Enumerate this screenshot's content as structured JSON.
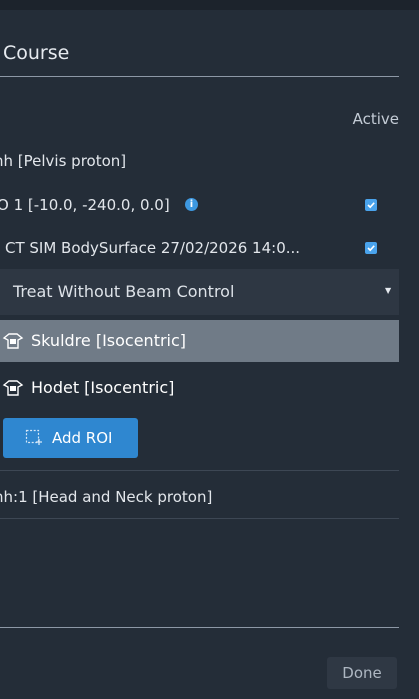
{
  "dialog": {
    "title": "Course",
    "column_header": "Active"
  },
  "plans": [
    {
      "label": "nh [Pelvis proton]"
    },
    {
      "label": "nh:1 [Head and Neck proton]"
    }
  ],
  "rows": {
    "isocenter": {
      "label": "O 1 [-10.0, -240.0, 0.0]",
      "info_icon": "info-icon",
      "active": true
    },
    "surface": {
      "label": "CT SIM BodySurface 27/02/2026 14:0...",
      "active": true
    }
  },
  "beam_control": {
    "selected": "Treat Without Beam Control"
  },
  "rois": [
    {
      "label": "Skuldre [Isocentric]",
      "icon": "roi-shape-icon",
      "selected": true
    },
    {
      "label": "Hodet [Isocentric]",
      "icon": "roi-shape-icon",
      "selected": false
    }
  ],
  "add_roi_button": {
    "label": "Add ROI",
    "icon": "add-roi-icon"
  },
  "footer": {
    "done_label": "Done"
  },
  "colors": {
    "background": "#242d38",
    "accent": "#2f87d0",
    "checkbox": "#4aa3ec",
    "selected_row": "#707b87"
  }
}
